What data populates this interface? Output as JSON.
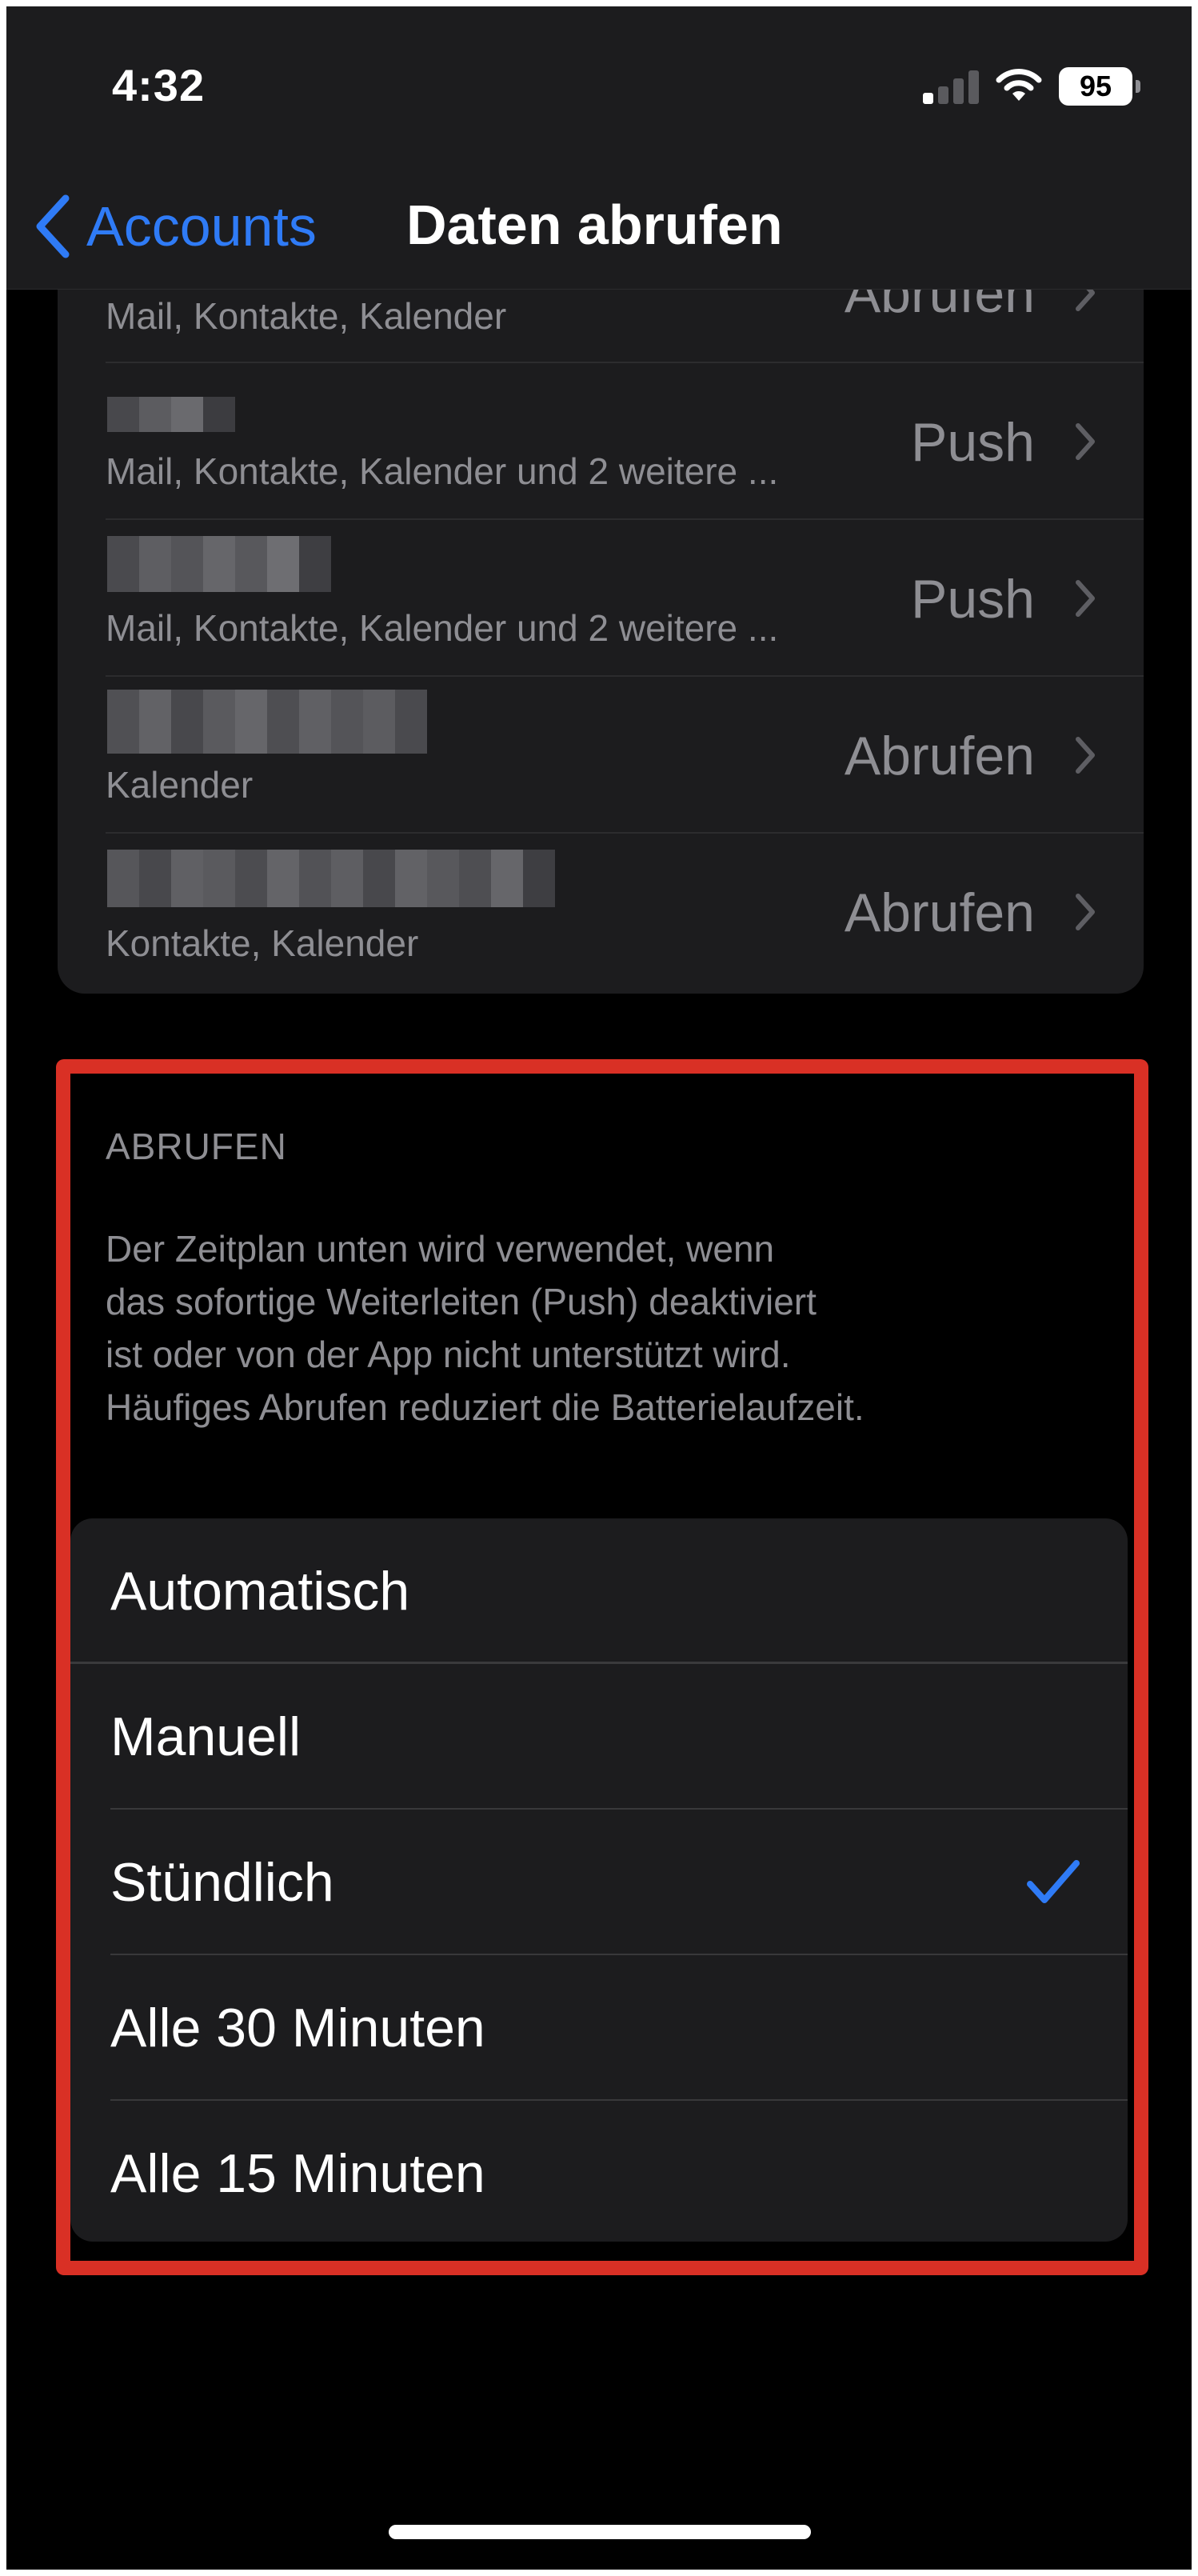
{
  "status_bar": {
    "time": "4:32",
    "battery": "95",
    "signal_bars_active": 1,
    "signal_bars_total": 4
  },
  "nav": {
    "back_label": "Accounts",
    "title": "Daten abrufen"
  },
  "accounts": [
    {
      "subtitle": "Mail, Kontakte, Kalender",
      "status": "Abrufen",
      "name_redacted": true
    },
    {
      "subtitle": "Mail, Kontakte, Kalender und 2 weitere ...",
      "status": "Push",
      "name_redacted": true
    },
    {
      "subtitle": "Mail, Kontakte, Kalender und 2 weitere ...",
      "status": "Push",
      "name_redacted": true
    },
    {
      "subtitle": "Kalender",
      "status": "Abrufen",
      "name_redacted": true
    },
    {
      "subtitle": "Kontakte, Kalender",
      "status": "Abrufen",
      "name_redacted": true
    }
  ],
  "fetch": {
    "header": "ABRUFEN",
    "footer": [
      "Der Zeitplan unten wird verwendet, wenn",
      "das sofortige Weiterleiten (Push) deaktiviert",
      "ist oder von der App nicht unterstützt wird.",
      "Häufiges Abrufen reduziert die Batterielaufzeit."
    ],
    "options": [
      "Automatisch",
      "Manuell",
      "Stündlich",
      "Alle 30 Minuten",
      "Alle 15 Minuten"
    ],
    "selected": "Stündlich"
  },
  "colors": {
    "accent": "#2f7bf6",
    "highlight": "#d93025",
    "background": "#000000",
    "cell": "#1c1c1e",
    "secondary_text": "#8e8e93"
  }
}
